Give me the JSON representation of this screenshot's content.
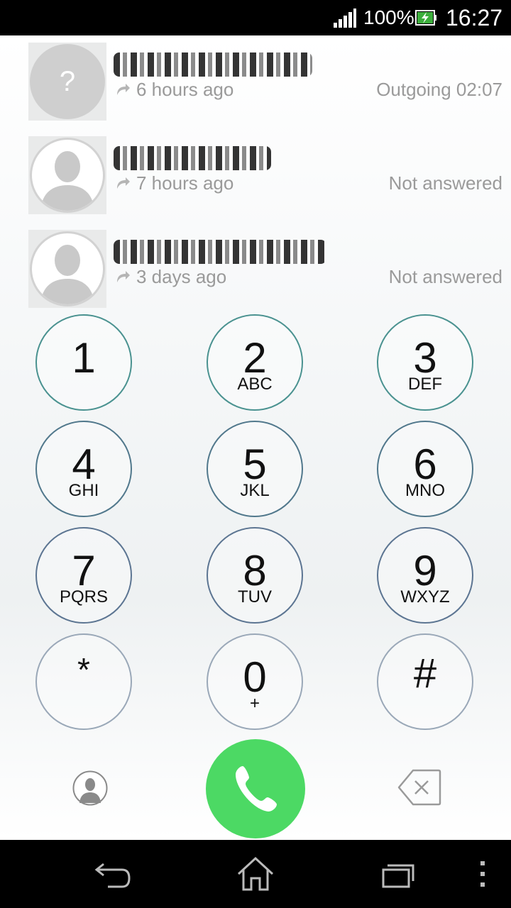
{
  "status_bar": {
    "battery_percent": "100%",
    "time": "16:27"
  },
  "recent_calls": [
    {
      "avatar_type": "unknown",
      "avatar_glyph": "?",
      "name": "",
      "time": "6 hours ago",
      "status": "Outgoing 02:07"
    },
    {
      "avatar_type": "person",
      "name": "",
      "time": "7 hours ago",
      "status": "Not answered"
    },
    {
      "avatar_type": "person",
      "name": "",
      "time": "3 days ago",
      "status": "Not answered"
    }
  ],
  "keypad": [
    {
      "digit": "1",
      "letters": ""
    },
    {
      "digit": "2",
      "letters": "ABC"
    },
    {
      "digit": "3",
      "letters": "DEF"
    },
    {
      "digit": "4",
      "letters": "GHI"
    },
    {
      "digit": "5",
      "letters": "JKL"
    },
    {
      "digit": "6",
      "letters": "MNO"
    },
    {
      "digit": "7",
      "letters": "PQRS"
    },
    {
      "digit": "8",
      "letters": "TUV"
    },
    {
      "digit": "9",
      "letters": "WXYZ"
    },
    {
      "digit": "*",
      "letters": ""
    },
    {
      "digit": "0",
      "letters": "+"
    },
    {
      "digit": "#",
      "letters": ""
    }
  ],
  "icons": {
    "contacts": "person-icon",
    "call": "phone-icon",
    "backspace": "backspace-icon",
    "nav_back": "back-icon",
    "nav_home": "home-icon",
    "nav_recents": "recent-apps-icon",
    "nav_menu": "menu-icon"
  },
  "colors": {
    "call_button": "#4cd964",
    "secondary_text": "#9a9a9a"
  }
}
